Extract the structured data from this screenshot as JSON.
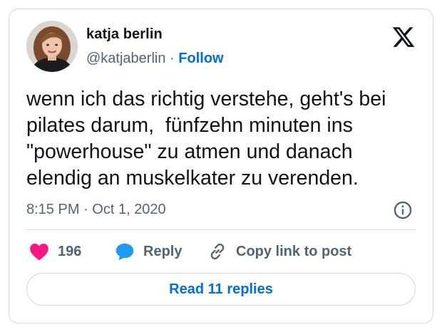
{
  "author": {
    "name": "katja berlin",
    "handle": "@katjaberlin",
    "separator": "·",
    "follow_label": "Follow"
  },
  "tweet": {
    "text": "wenn ich das richtig verstehe, geht's bei\npilates darum,  fünfzehn minuten ins\n\"powerhouse\" zu atmen und danach\nelendig an muskelkater zu verenden.",
    "time": "8:15 PM",
    "date_separator": "·",
    "date": "Oct 1, 2020"
  },
  "actions": {
    "like_count": "196",
    "reply_label": "Reply",
    "copy_label": "Copy link to post"
  },
  "read_replies_label": "Read 11 replies",
  "colors": {
    "like": "#f91880",
    "reply": "#1d9bf0",
    "link": "#006fd6",
    "secondary_text": "#536471",
    "border": "#cfd9de"
  },
  "icons": {
    "logo": "x-logo-icon",
    "info": "info-icon",
    "like": "heart-icon",
    "reply": "speech-bubble-icon",
    "copy": "link-icon"
  }
}
